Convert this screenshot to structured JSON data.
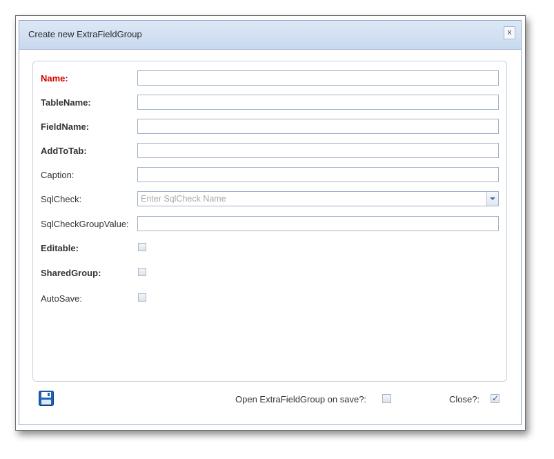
{
  "dialog": {
    "title": "Create new ExtraFieldGroup",
    "close_label": "x"
  },
  "form": {
    "name_label": "Name:",
    "tablename_label": "TableName:",
    "fieldname_label": "FieldName:",
    "addtotab_label": "AddToTab:",
    "caption_label": "Caption:",
    "sqlcheck_label": "SqlCheck:",
    "sqlcheck_placeholder": "Enter SqlCheck Name",
    "sqlcheckgroupvalue_label": "SqlCheckGroupValue:",
    "editable_label": "Editable:",
    "sharedgroup_label": "SharedGroup:",
    "autosave_label": "AutoSave:",
    "values": {
      "name": "",
      "tablename": "",
      "fieldname": "",
      "addtotab": "",
      "caption": "",
      "sqlcheckgroupvalue": ""
    },
    "editable_checked": false,
    "sharedgroup_checked": false,
    "autosave_checked": false
  },
  "footer": {
    "open_on_save_label": "Open ExtraFieldGroup on save?:",
    "open_on_save_checked": false,
    "close_label": "Close?:",
    "close_checked": true,
    "save_icon": "floppy-disk-icon"
  },
  "colors": {
    "required": "#d00000",
    "titlebar": "#c9d9ee",
    "accent": "#2f5d9a"
  }
}
